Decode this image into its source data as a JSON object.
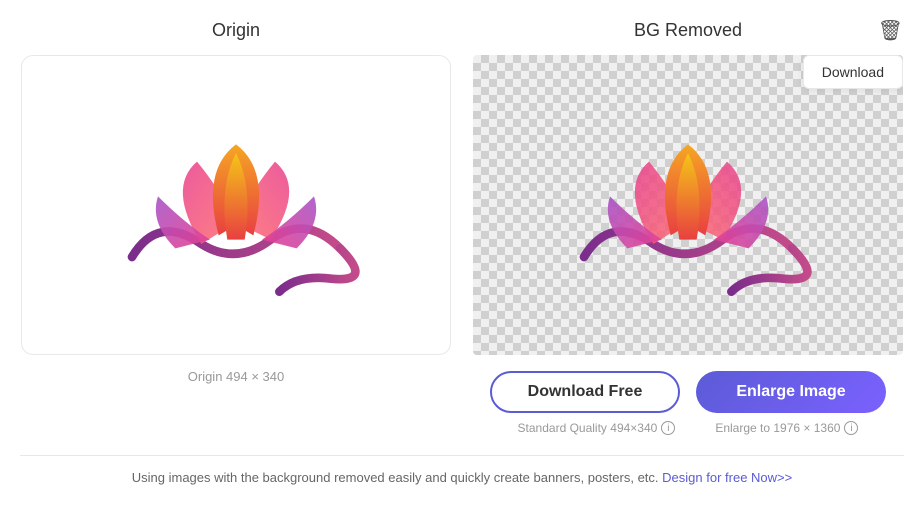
{
  "left_panel": {
    "title": "Origin",
    "size_label": "Origin 494 × 340"
  },
  "right_panel": {
    "title": "BG Removed",
    "download_button_label": "Download"
  },
  "actions": {
    "download_free_label": "Download Free",
    "enlarge_label": "Enlarge Image",
    "standard_quality_label": "Standard Quality 494×340",
    "enlarge_quality_label": "Enlarge to 1976 × 1360"
  },
  "footer": {
    "text": "Using images with the background removed easily and quickly create banners, posters, etc.",
    "link_text": "Design for free Now>>"
  },
  "icons": {
    "delete": "🗑",
    "info": "i"
  }
}
